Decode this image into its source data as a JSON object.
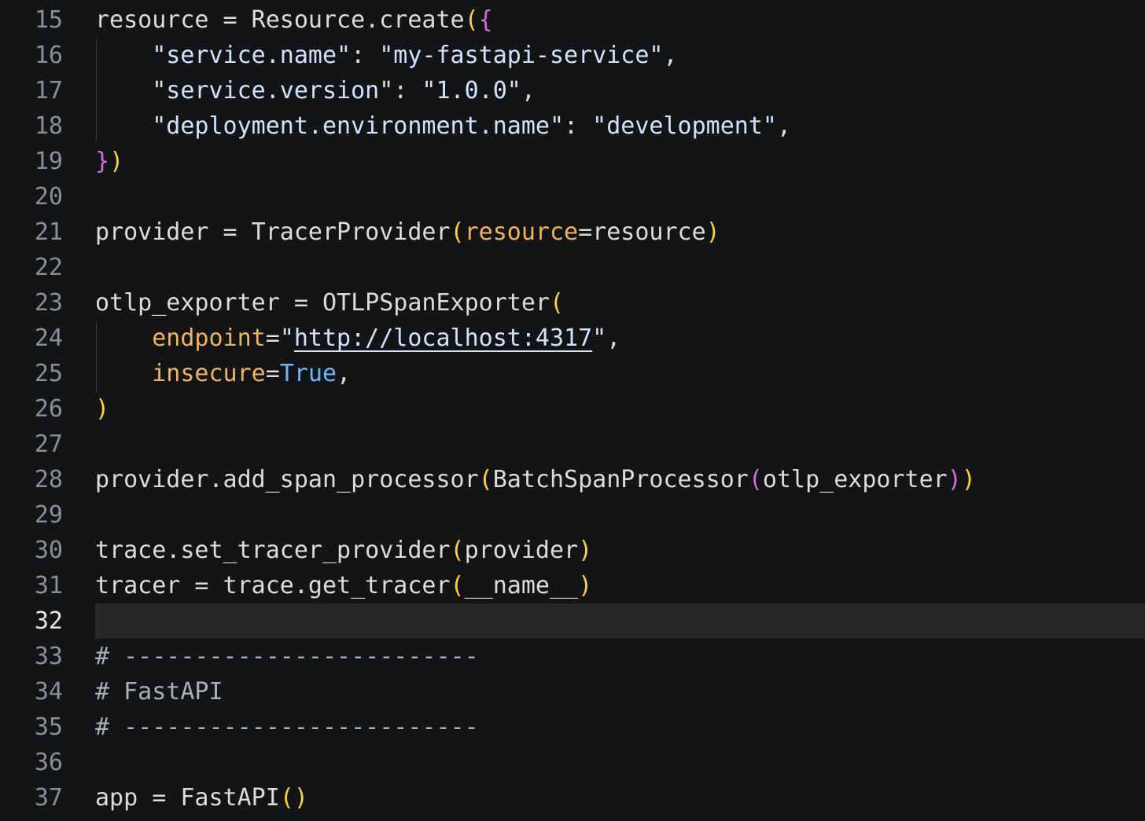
{
  "editor": {
    "colors": {
      "background": "#121416",
      "current_line": "#262729",
      "text": "#dcdcdc",
      "string": "#cfe3ff",
      "parameter": "#f0b45a",
      "keyword": "#6cb6ff",
      "bracket_level1": "#ffd43b",
      "bracket_level2": "#d46bd6",
      "line_number": "#8a8f96"
    },
    "current_line": 32,
    "lines": [
      {
        "n": "15",
        "tokens": [
          {
            "t": "resource = Resource.create",
            "c": "text"
          },
          {
            "t": "(",
            "c": "paren1"
          },
          {
            "t": "{",
            "c": "paren2"
          }
        ]
      },
      {
        "n": "16",
        "tokens": [
          {
            "t": "    \"service.name\"",
            "c": "str"
          },
          {
            "t": ": ",
            "c": "text"
          },
          {
            "t": "\"my-fastapi-service\"",
            "c": "str"
          },
          {
            "t": ",",
            "c": "text"
          }
        ]
      },
      {
        "n": "17",
        "tokens": [
          {
            "t": "    \"service.version\"",
            "c": "str"
          },
          {
            "t": ": ",
            "c": "text"
          },
          {
            "t": "\"1.0.0\"",
            "c": "str"
          },
          {
            "t": ",",
            "c": "text"
          }
        ]
      },
      {
        "n": "18",
        "tokens": [
          {
            "t": "    \"deployment.environment.name\"",
            "c": "str"
          },
          {
            "t": ": ",
            "c": "text"
          },
          {
            "t": "\"development\"",
            "c": "str"
          },
          {
            "t": ",",
            "c": "text"
          }
        ]
      },
      {
        "n": "19",
        "tokens": [
          {
            "t": "}",
            "c": "paren2"
          },
          {
            "t": ")",
            "c": "paren1"
          }
        ]
      },
      {
        "n": "20",
        "tokens": []
      },
      {
        "n": "21",
        "tokens": [
          {
            "t": "provider = TracerProvider",
            "c": "text"
          },
          {
            "t": "(",
            "c": "paren1"
          },
          {
            "t": "resource",
            "c": "param"
          },
          {
            "t": "=resource",
            "c": "text"
          },
          {
            "t": ")",
            "c": "paren1"
          }
        ]
      },
      {
        "n": "22",
        "tokens": []
      },
      {
        "n": "23",
        "tokens": [
          {
            "t": "otlp_exporter = OTLPSpanExporter",
            "c": "text"
          },
          {
            "t": "(",
            "c": "paren1"
          }
        ]
      },
      {
        "n": "24",
        "tokens": [
          {
            "t": "    ",
            "c": "text"
          },
          {
            "t": "endpoint",
            "c": "param"
          },
          {
            "t": "=",
            "c": "text"
          },
          {
            "t": "\"",
            "c": "str"
          },
          {
            "t": "http://localhost:4317",
            "c": "url"
          },
          {
            "t": "\"",
            "c": "str"
          },
          {
            "t": ",",
            "c": "text"
          }
        ]
      },
      {
        "n": "25",
        "tokens": [
          {
            "t": "    ",
            "c": "text"
          },
          {
            "t": "insecure",
            "c": "param"
          },
          {
            "t": "=",
            "c": "text"
          },
          {
            "t": "True",
            "c": "kw"
          },
          {
            "t": ",",
            "c": "text"
          }
        ]
      },
      {
        "n": "26",
        "tokens": [
          {
            "t": ")",
            "c": "paren1"
          }
        ]
      },
      {
        "n": "27",
        "tokens": []
      },
      {
        "n": "28",
        "tokens": [
          {
            "t": "provider.add_span_processor",
            "c": "text"
          },
          {
            "t": "(",
            "c": "paren1"
          },
          {
            "t": "BatchSpanProcessor",
            "c": "text"
          },
          {
            "t": "(",
            "c": "paren2"
          },
          {
            "t": "otlp_exporter",
            "c": "text"
          },
          {
            "t": ")",
            "c": "paren2"
          },
          {
            "t": ")",
            "c": "paren1"
          }
        ]
      },
      {
        "n": "29",
        "tokens": []
      },
      {
        "n": "30",
        "tokens": [
          {
            "t": "trace.set_tracer_provider",
            "c": "text"
          },
          {
            "t": "(",
            "c": "paren1"
          },
          {
            "t": "provider",
            "c": "text"
          },
          {
            "t": ")",
            "c": "paren1"
          }
        ]
      },
      {
        "n": "31",
        "tokens": [
          {
            "t": "tracer = trace.get_tracer",
            "c": "text"
          },
          {
            "t": "(",
            "c": "paren1"
          },
          {
            "t": "__name__",
            "c": "text"
          },
          {
            "t": ")",
            "c": "paren1"
          }
        ]
      },
      {
        "n": "32",
        "tokens": []
      },
      {
        "n": "33",
        "tokens": [
          {
            "t": "# -------------------------",
            "c": "comment"
          }
        ]
      },
      {
        "n": "34",
        "tokens": [
          {
            "t": "# FastAPI",
            "c": "comment"
          }
        ]
      },
      {
        "n": "35",
        "tokens": [
          {
            "t": "# -------------------------",
            "c": "comment"
          }
        ]
      },
      {
        "n": "36",
        "tokens": []
      },
      {
        "n": "37",
        "tokens": [
          {
            "t": "app = FastAPI",
            "c": "text"
          },
          {
            "t": "(",
            "c": "paren1"
          },
          {
            "t": ")",
            "c": "paren1"
          }
        ]
      }
    ]
  }
}
